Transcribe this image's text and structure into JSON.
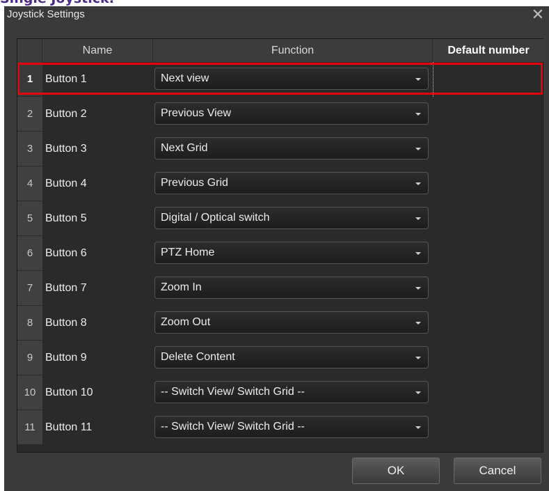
{
  "page_heading": "Single Joystick:",
  "dialog": {
    "title": "Joystick Settings",
    "close_icon": "close-icon",
    "columns": {
      "number": "",
      "name": "Name",
      "function": "Function",
      "default_number": "Default number"
    },
    "rows": [
      {
        "number": "1",
        "name": "Button 1",
        "function": "Next view",
        "default_number": ""
      },
      {
        "number": "2",
        "name": "Button 2",
        "function": "Previous View",
        "default_number": ""
      },
      {
        "number": "3",
        "name": "Button 3",
        "function": "Next Grid",
        "default_number": ""
      },
      {
        "number": "4",
        "name": "Button 4",
        "function": "Previous Grid",
        "default_number": ""
      },
      {
        "number": "5",
        "name": "Button 5",
        "function": "Digital / Optical switch",
        "default_number": ""
      },
      {
        "number": "6",
        "name": "Button 6",
        "function": "PTZ Home",
        "default_number": ""
      },
      {
        "number": "7",
        "name": "Button 7",
        "function": "Zoom In",
        "default_number": ""
      },
      {
        "number": "8",
        "name": "Button 8",
        "function": "Zoom Out",
        "default_number": ""
      },
      {
        "number": "9",
        "name": "Button 9",
        "function": "Delete Content",
        "default_number": ""
      },
      {
        "number": "10",
        "name": "Button 10",
        "function": "-- Switch View/ Switch Grid --",
        "default_number": ""
      },
      {
        "number": "11",
        "name": "Button 11",
        "function": "-- Switch View/ Switch Grid --",
        "default_number": ""
      }
    ],
    "selected_row": "1",
    "ok_label": "OK",
    "cancel_label": "Cancel"
  },
  "colors": {
    "highlight": "#e8000b",
    "background": "#3b3b3b",
    "heading": "#4a2a8a"
  }
}
